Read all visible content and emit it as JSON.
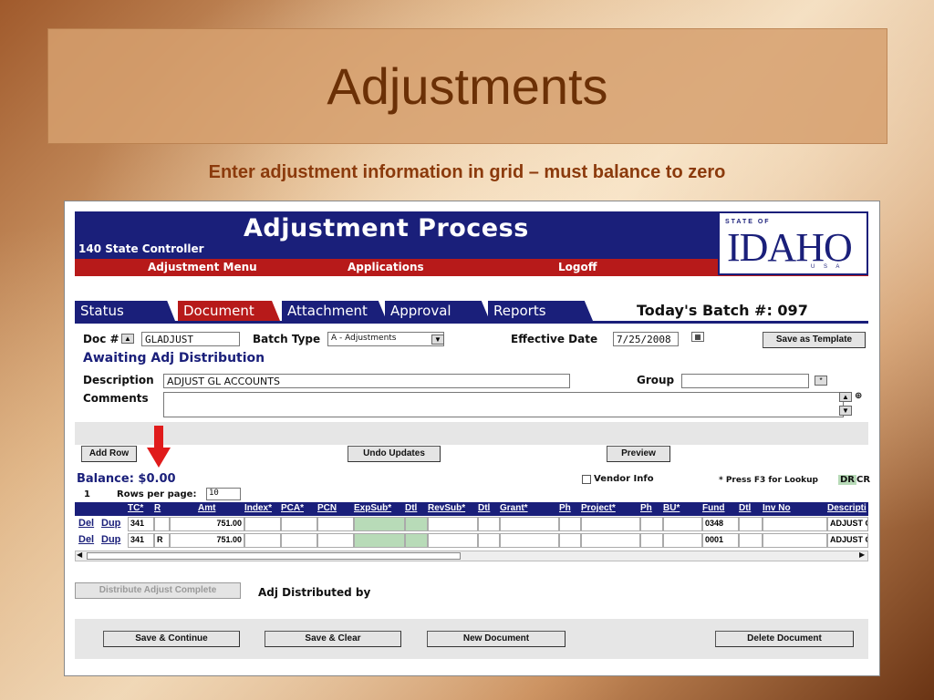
{
  "slide": {
    "title": "Adjustments",
    "subtitle": "Enter adjustment information in grid – must balance to zero"
  },
  "app": {
    "title": "Adjustment Process",
    "org": "140 State Controller",
    "logo": {
      "state_of": "STATE OF",
      "name": "IDAHO",
      "usa": "U S A"
    },
    "menu": [
      "Adjustment Menu",
      "Applications",
      "Logoff"
    ],
    "tabs": [
      "Status",
      "Document",
      "Attachment",
      "Approval",
      "Reports"
    ],
    "active_tab": "Document",
    "batch_label": "Today's Batch #: 097"
  },
  "form": {
    "doc_label": "Doc #",
    "doc_value": "GLADJUST",
    "batch_type_label": "Batch Type",
    "batch_type_value": "A - Adjustments",
    "effective_date_label": "Effective Date",
    "effective_date_value": "7/25/2008",
    "save_template": "Save as Template",
    "status": "Awaiting Adj Distribution",
    "description_label": "Description",
    "description_value": "ADJUST GL ACCOUNTS",
    "group_label": "Group",
    "group_value": "",
    "comments_label": "Comments",
    "comments_value": ""
  },
  "actions": {
    "add_row": "Add Row",
    "undo_updates": "Undo Updates",
    "preview": "Preview"
  },
  "grid_info": {
    "balance": "Balance: $0.00",
    "page": "1",
    "rows_per_page_label": "Rows per page:",
    "rows_per_page_value": "10",
    "vendor_info": "Vendor Info",
    "lookup_hint": "* Press F3 for Lookup",
    "dr": "DR",
    "cr": "CR"
  },
  "grid": {
    "headers": [
      "TC*",
      "R",
      "Amt",
      "Index*",
      "PCA*",
      "PCN",
      "ExpSub*",
      "Dtl",
      "RevSub*",
      "Dtl",
      "Grant*",
      "Ph",
      "Project*",
      "Ph",
      "BU*",
      "Fund",
      "Dtl",
      "Inv No",
      "Descripti"
    ],
    "row_links": [
      "Del",
      "Dup"
    ],
    "rows": [
      {
        "tc": "341",
        "r": "",
        "amt": "751.00",
        "fund": "0348",
        "desc": "ADJUST G"
      },
      {
        "tc": "341",
        "r": "R",
        "amt": "751.00",
        "fund": "0001",
        "desc": "ADJUST G"
      }
    ]
  },
  "footer": {
    "distribute": "Distribute Adjust Complete",
    "distributed_by": "Adj Distributed by",
    "save_continue": "Save & Continue",
    "save_clear": "Save & Clear",
    "new_document": "New Document",
    "delete_document": "Delete Document"
  },
  "colors": {
    "navy": "#1a1f7a",
    "red": "#b71a1a",
    "green_cell": "#b8dbb8"
  }
}
